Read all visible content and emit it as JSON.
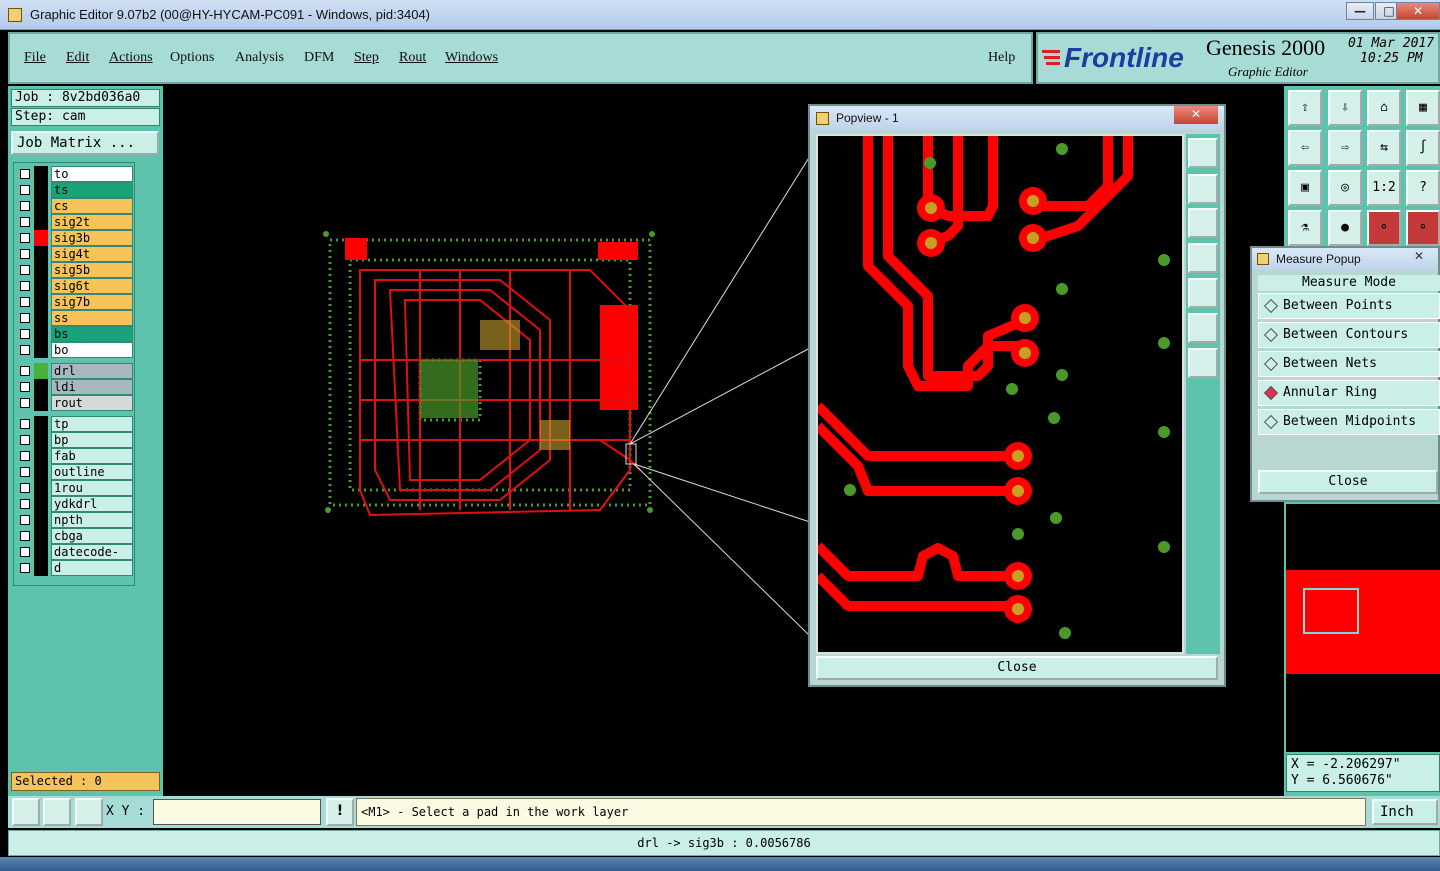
{
  "window": {
    "title": "Graphic Editor 9.07b2 (00@HY-HYCAM-PC091 - Windows, pid:3404)"
  },
  "menu": [
    "File",
    "Edit",
    "Actions",
    "Options",
    "Analysis",
    "DFM",
    "Step",
    "Rout",
    "Windows"
  ],
  "help_label": "Help",
  "brand": {
    "logo": "Frontline",
    "product": "Genesis 2000",
    "subtitle": "Graphic Editor",
    "date": "01 Mar 2017",
    "time": "10:25 PM"
  },
  "job": {
    "label": "Job : 8v2bd036a0",
    "step": "Step: cam",
    "matrix_button": "Job Matrix ..."
  },
  "layers": [
    {
      "name": "to",
      "color": "#ffffff",
      "swatch": "#000000"
    },
    {
      "name": "ts",
      "color": "#1aa37a",
      "swatch": "#000000"
    },
    {
      "name": "cs",
      "color": "#f6c35a",
      "swatch": "#000000"
    },
    {
      "name": "sig2t",
      "color": "#f6c35a",
      "swatch": "#000000"
    },
    {
      "name": "sig3b",
      "color": "#f6c35a",
      "swatch": "#ff0000"
    },
    {
      "name": "sig4t",
      "color": "#f6c35a",
      "swatch": "#000000"
    },
    {
      "name": "sig5b",
      "color": "#f6c35a",
      "swatch": "#000000"
    },
    {
      "name": "sig6t",
      "color": "#f6c35a",
      "swatch": "#000000"
    },
    {
      "name": "sig7b",
      "color": "#f6c35a",
      "swatch": "#000000"
    },
    {
      "name": "ss",
      "color": "#f6c35a",
      "swatch": "#000000"
    },
    {
      "name": "bs",
      "color": "#1aa37a",
      "swatch": "#000000"
    },
    {
      "name": "bo",
      "color": "#ffffff",
      "swatch": "#000000"
    },
    {
      "name": "drl",
      "color": "#a8b8c0",
      "swatch": "#4caf3a"
    },
    {
      "name": "ldi",
      "color": "#a8b8c0",
      "swatch": "#000000"
    },
    {
      "name": "rout",
      "color": "#d8d8d8",
      "swatch": "#000000"
    },
    {
      "name": "tp",
      "color": "#c9efe7",
      "swatch": "#000000"
    },
    {
      "name": "bp",
      "color": "#c9efe7",
      "swatch": "#000000"
    },
    {
      "name": "fab",
      "color": "#c9efe7",
      "swatch": "#000000"
    },
    {
      "name": "outline",
      "color": "#c9efe7",
      "swatch": "#000000"
    },
    {
      "name": "1rou",
      "color": "#c9efe7",
      "swatch": "#000000"
    },
    {
      "name": "ydkdrl",
      "color": "#c9efe7",
      "swatch": "#000000"
    },
    {
      "name": "npth",
      "color": "#c9efe7",
      "swatch": "#000000"
    },
    {
      "name": "cbga",
      "color": "#c9efe7",
      "swatch": "#000000"
    },
    {
      "name": "datecode-ss",
      "color": "#c9efe7",
      "swatch": "#000000"
    },
    {
      "name": "d",
      "color": "#c9efe7",
      "swatch": "#000000"
    }
  ],
  "selected": "Selected : 0",
  "xy_label": "X Y :",
  "xy_value": "",
  "prompt": "<M1> - Select a pad in the work layer",
  "status": "drl -> sig3b : 0.0056786",
  "units": "Inch",
  "coords": {
    "x": "X = -2.206297\"",
    "y": "Y = 6.560676\""
  },
  "popview": {
    "title": "Popview - 1",
    "close": "Close"
  },
  "measure": {
    "title": "Measure Popup",
    "mode_label": "Measure Mode",
    "options": [
      {
        "label": "Between Points",
        "selected": false
      },
      {
        "label": "Between Contours",
        "selected": false
      },
      {
        "label": "Between Nets",
        "selected": false
      },
      {
        "label": "Annular Ring",
        "selected": true
      },
      {
        "label": "Between Midpoints",
        "selected": false
      }
    ],
    "close": "Close"
  },
  "toolbar_right": [
    "1:2",
    "?"
  ]
}
